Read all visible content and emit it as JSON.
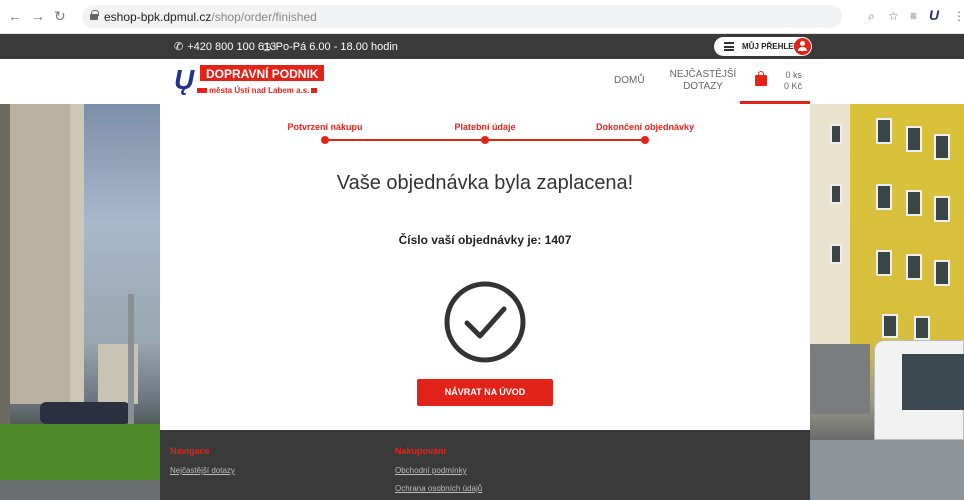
{
  "browser": {
    "url_host": "eshop-bpk.dpmul.cz",
    "url_path": "/shop/order/finished"
  },
  "topbar": {
    "phone": "+420 800 100 613",
    "hours": "Po-Pá 6.00 - 18.00 hodin",
    "my_overview": "MŮJ PŘEHLED"
  },
  "header": {
    "logo_title": "DOPRAVNÍ PODNIK",
    "logo_subtitle": "města Ústí nad Labem a.s.",
    "menu_home": "DOMŮ",
    "menu_faq_line1": "NEJČASTĚJŠÍ",
    "menu_faq_line2": "DOTAZY",
    "cart_count": "0 ks",
    "cart_total": "0 Kč"
  },
  "steps": [
    {
      "label": "Potvrzení nákupu"
    },
    {
      "label": "Platební údaje"
    },
    {
      "label": "Dokončení objednávky"
    }
  ],
  "main": {
    "heading": "Vaše objednávka byla zaplacena!",
    "order_text": "Číslo vaší objednávky je: 1407",
    "back_button": "NÁVRAT NA ÚVOD"
  },
  "footer": {
    "nav_heading": "Navigace",
    "nav_links": [
      "Nejčastější dotazy"
    ],
    "shopping_heading": "Nakupování",
    "shopping_links": [
      "Obchodní podmínky",
      "Ochrana osobních údajů"
    ]
  },
  "colors": {
    "accent": "#e2231a",
    "dark": "#3a3a3a",
    "brand_blue": "#24348c"
  }
}
